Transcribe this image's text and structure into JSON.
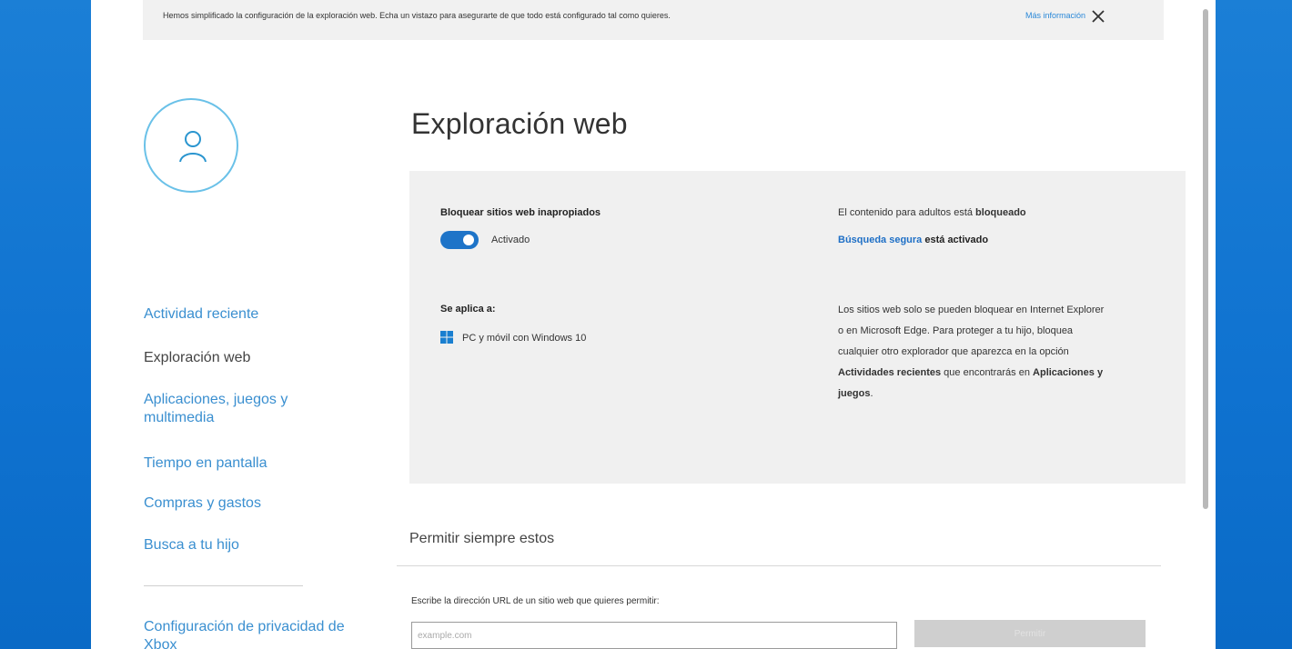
{
  "banner": {
    "message": "Hemos simplificado la configuración de la exploración web. Echa un vistazo para asegurarte de que todo está configurado tal como quieres.",
    "link": "Más información"
  },
  "icons": {
    "close": "close-icon",
    "avatar": "person-icon",
    "windows": "windows-logo-icon"
  },
  "sidebar": {
    "items": [
      {
        "label": "Actividad reciente"
      },
      {
        "label": "Exploración web"
      },
      {
        "label": "Aplicaciones, juegos y multimedia"
      },
      {
        "label": "Tiempo en pantalla"
      },
      {
        "label": "Compras y gastos"
      },
      {
        "label": "Busca a tu hijo"
      },
      {
        "label": "Configuración de privacidad de Xbox"
      }
    ]
  },
  "main": {
    "title": "Exploración web",
    "block": {
      "label": "Bloquear sitios web inapropiados",
      "toggle_state": "Activado",
      "toggle_on": true
    },
    "applies": {
      "label": "Se aplica a:",
      "device": "PC y móvil con Windows 10"
    },
    "status": {
      "adult_prefix": "El contenido para adultos está ",
      "adult_value": "bloqueado",
      "safesearch_link": "Búsqueda segura",
      "safesearch_suffix": " está activado"
    },
    "note": {
      "part1": "Los sitios web solo se pueden bloquear en Internet Explorer o en Microsoft Edge. Para proteger a tu hijo, bloquea cualquier otro explorador que aparezca en la opción ",
      "bold1": "Actividades recientes",
      "part2": " que encontrarás en ",
      "bold2": "Aplicaciones y juegos",
      "part3": "."
    },
    "allow": {
      "title": "Permitir siempre estos",
      "url_label": "Escribe la dirección URL de un sitio web que quieres permitir:",
      "url_placeholder": "example.com",
      "url_value": "",
      "add_button": "Permitir"
    }
  },
  "colors": {
    "accent": "#1e74c8",
    "link": "#3a8fd0",
    "desktop": "#0f72d0",
    "panel": "#f0f0f0"
  }
}
